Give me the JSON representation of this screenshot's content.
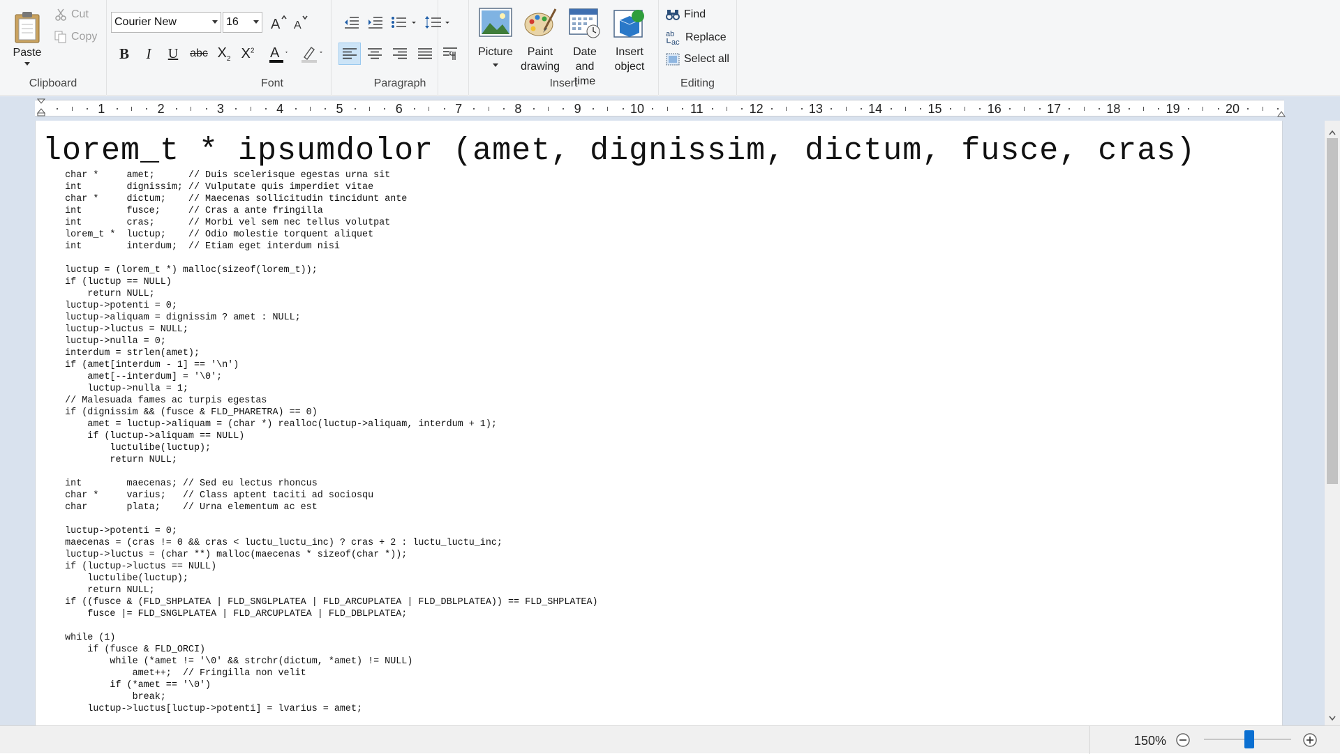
{
  "ribbon": {
    "clipboard": {
      "label": "Clipboard",
      "paste": "Paste",
      "cut": "Cut",
      "copy": "Copy"
    },
    "font": {
      "label": "Font",
      "family": "Courier New",
      "size": "16"
    },
    "paragraph": {
      "label": "Paragraph"
    },
    "insert": {
      "label": "Insert",
      "picture": "Picture",
      "paint_drawing_1": "Paint",
      "paint_drawing_2": "drawing",
      "date_time_1": "Date and",
      "date_time_2": "time",
      "insert_object_1": "Insert",
      "insert_object_2": "object"
    },
    "editing": {
      "label": "Editing",
      "find": "Find",
      "replace": "Replace",
      "select_all": "Select all"
    }
  },
  "ruler": {
    "numbers": [
      "1",
      "2",
      "3",
      "4",
      "5",
      "6",
      "7",
      "8",
      "9",
      "10",
      "11",
      "12",
      "13",
      "14",
      "15",
      "16",
      "17",
      "18",
      "19",
      "20"
    ]
  },
  "document": {
    "heading": "lorem_t * ipsumdolor (amet, dignissim, dictum, fusce, cras)",
    "lines": [
      "    char *     amet;      // Duis scelerisque egestas urna sit",
      "    int        dignissim; // Vulputate quis imperdiet vitae",
      "    char *     dictum;    // Maecenas sollicitudin tincidunt ante",
      "    int        fusce;     // Cras a ante fringilla",
      "    int        cras;      // Morbi vel sem nec tellus volutpat",
      "    lorem_t *  luctup;    // Odio molestie torquent aliquet",
      "    int        interdum;  // Etiam eget interdum nisi",
      "",
      "    luctup = (lorem_t *) malloc(sizeof(lorem_t));",
      "    if (luctup == NULL)",
      "        return NULL;",
      "    luctup->potenti = 0;",
      "    luctup->aliquam = dignissim ? amet : NULL;",
      "    luctup->luctus = NULL;",
      "    luctup->nulla = 0;",
      "    interdum = strlen(amet);",
      "    if (amet[interdum - 1] == '\\n')",
      "        amet[--interdum] = '\\0';",
      "        luctup->nulla = 1;",
      "    // Malesuada fames ac turpis egestas",
      "    if (dignissim && (fusce & FLD_PHARETRA) == 0)",
      "        amet = luctup->aliquam = (char *) realloc(luctup->aliquam, interdum + 1);",
      "        if (luctup->aliquam == NULL)",
      "            luctulibe(luctup);",
      "            return NULL;",
      "",
      "    int        maecenas; // Sed eu lectus rhoncus",
      "    char *     varius;   // Class aptent taciti ad sociosqu",
      "    char       plata;    // Urna elementum ac est",
      "",
      "    luctup->potenti = 0;",
      "    maecenas = (cras != 0 && cras < luctu_luctu_inc) ? cras + 2 : luctu_luctu_inc;",
      "    luctup->luctus = (char **) malloc(maecenas * sizeof(char *));",
      "    if (luctup->luctus == NULL)",
      "        luctulibe(luctup);",
      "        return NULL;",
      "    if ((fusce & (FLD_SHPLATEA | FLD_SNGLPLATEA | FLD_ARCUPLATEA | FLD_DBLPLATEA)) == FLD_SHPLATEA)",
      "        fusce |= FLD_SNGLPLATEA | FLD_ARCUPLATEA | FLD_DBLPLATEA;",
      "",
      "    while (1)",
      "        if (fusce & FLD_ORCI)",
      "            while (*amet != '\\0' && strchr(dictum, *amet) != NULL)",
      "                amet++;  // Fringilla non velit",
      "            if (*amet == '\\0')",
      "                break;",
      "        luctup->luctus[luctup->potenti] = lvarius = amet;"
    ]
  },
  "status": {
    "zoom": "150%"
  }
}
